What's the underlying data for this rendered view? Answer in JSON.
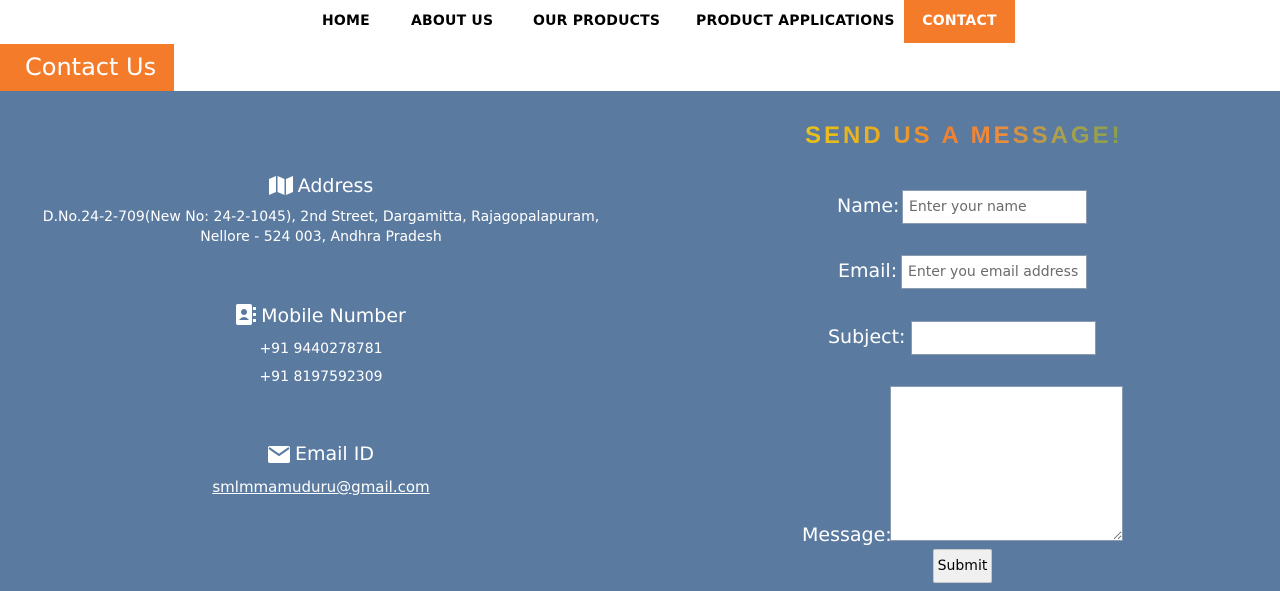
{
  "nav": {
    "items": [
      {
        "label": "HOME"
      },
      {
        "label": "ABOUT US"
      },
      {
        "label": "OUR PRODUCTS"
      },
      {
        "label": "PRODUCT APPLICATIONS"
      },
      {
        "label": "CONTACT",
        "active": true
      }
    ]
  },
  "page_title": "Contact Us",
  "contact_info": {
    "address": {
      "heading": "Address",
      "icon": "map-icon",
      "line1": "D.No.24-2-709(New No: 24-2-1045), 2nd Street, Dargamitta, Rajagopalapuram,",
      "line2": "Nellore - 524 003, Andhra Pradesh"
    },
    "mobile": {
      "heading": "Mobile Number",
      "icon": "address-book-icon",
      "numbers": [
        "+91 9440278781",
        "+91 8197592309"
      ]
    },
    "email": {
      "heading": "Email ID",
      "icon": "envelope-icon",
      "address": "smlmmamuduru@gmail.com"
    }
  },
  "form": {
    "title": "SEND US A MESSAGE!",
    "name_label": "Name:",
    "name_placeholder": "Enter your name",
    "email_label": "Email:",
    "email_placeholder": "Enter you email address",
    "subject_label": "Subject:",
    "message_label": "Message:",
    "submit_label": "Submit"
  },
  "colors": {
    "accent": "#f47b2a",
    "panel_bg": "#5a7aa0"
  }
}
